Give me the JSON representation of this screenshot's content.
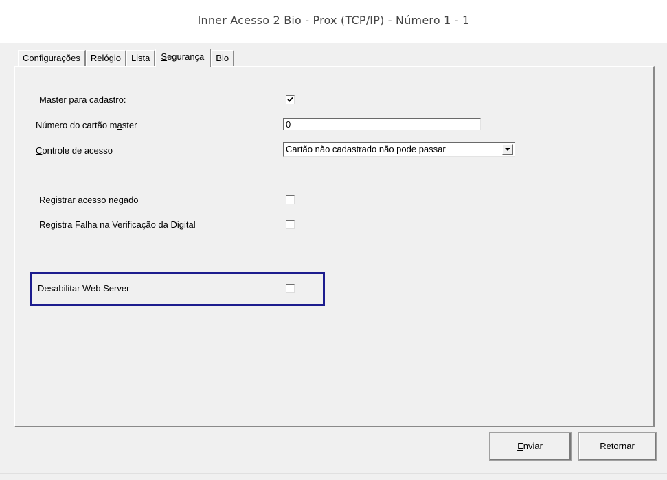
{
  "window": {
    "title": "Inner Acesso 2 Bio - Prox (TCP/IP) - Número 1 - 1"
  },
  "tabs": [
    {
      "label_u": "C",
      "label_rest": "onfigurações",
      "active": false
    },
    {
      "label_u": "R",
      "label_rest": "elógio",
      "active": false
    },
    {
      "label_u": "L",
      "label_rest": "ista",
      "active": false
    },
    {
      "label_u": "S",
      "label_rest": "egurança",
      "active": true
    },
    {
      "label_u": "B",
      "label_rest": "io",
      "active": false
    }
  ],
  "form": {
    "master_cadastro": {
      "label": "Master para cadastro:",
      "checked": true
    },
    "numero_cartao_master": {
      "label_pre": "Número do cartão m",
      "label_u": "a",
      "label_post": "ster",
      "value": "0"
    },
    "controle_acesso": {
      "label_u": "C",
      "label_rest": "ontrole de acesso",
      "selected": "Cartão não cadastrado não pode passar"
    },
    "registrar_acesso_negado": {
      "label": "Registrar acesso negado",
      "checked": false
    },
    "registra_falha_digital": {
      "label": "Registra Falha na Verificação da Digital",
      "checked": false
    },
    "desabilitar_web_server": {
      "label": "Desabilitar Web Server",
      "checked": false
    }
  },
  "buttons": {
    "enviar": {
      "label_u": "E",
      "label_rest": "nviar"
    },
    "retornar": {
      "label": "Retornar"
    }
  },
  "colors": {
    "highlight_border": "#1c1c8e"
  }
}
